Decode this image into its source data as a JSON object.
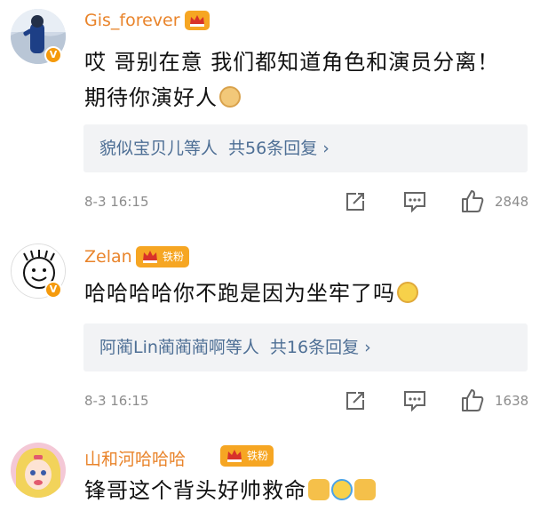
{
  "comments": [
    {
      "username": "Gis_forever",
      "text": "哎 哥别在意 我们都知道角色和演员分离！期待你演好人",
      "reply_preview": "貌似宝贝儿等人",
      "reply_count": "共56条回复 ›",
      "timestamp": "8-3 16:15",
      "likes": "2848",
      "emoji": "doge-emoji"
    },
    {
      "username": "Zelan",
      "fan_tag": "铁粉",
      "text": "哈哈哈哈你不跑是因为坐牢了吗",
      "reply_preview": "阿蔺Lin蔺蔺蔺啊等人",
      "reply_count": "共16条回复 ›",
      "timestamp": "8-3 16:15",
      "likes": "1638",
      "emoji": "laugh-emoji"
    },
    {
      "username": "山和河哈哈哈",
      "fan_tag": "铁粉",
      "text": "锋哥这个背头好帅救命",
      "emoji": "thumb-cry-thumb-emoji"
    }
  ],
  "colors": {
    "username": "#e9842b",
    "reply_link": "#4e6f95",
    "meta": "#8c8c8c",
    "badge": "#f6a623"
  },
  "icons": [
    "share-icon",
    "comment-icon",
    "like-icon",
    "verified-badge-icon",
    "crown-icon"
  ]
}
